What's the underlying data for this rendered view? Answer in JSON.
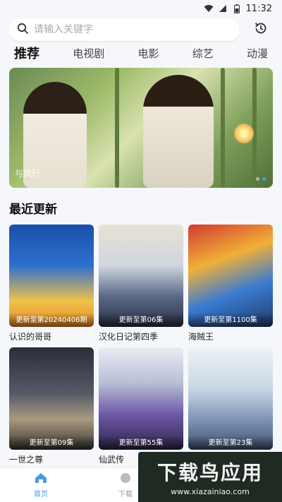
{
  "status_bar": {
    "time": "11:32"
  },
  "search": {
    "placeholder": "请输入关键字"
  },
  "tabs": [
    {
      "label": "推荐",
      "active": true
    },
    {
      "label": "电视剧"
    },
    {
      "label": "电影"
    },
    {
      "label": "综艺"
    },
    {
      "label": "动漫"
    }
  ],
  "banner": {
    "caption": "与凤行",
    "active_dot": 2,
    "dot_count": 2
  },
  "recent": {
    "title": "最近更新",
    "items": [
      {
        "title": "认识的哥哥",
        "update": "更新至第20240406期"
      },
      {
        "title": "汉化日记第四季",
        "update": "更新至第06集"
      },
      {
        "title": "海贼王",
        "update": "更新至第1100集"
      },
      {
        "title": "一世之尊",
        "update": "更新至第09集"
      },
      {
        "title": "仙武传",
        "update": "更新至第55集"
      },
      {
        "title": "",
        "update": "更新至第23集"
      }
    ]
  },
  "bottom_nav": [
    {
      "label": "首页",
      "icon": "home-icon",
      "active": true
    },
    {
      "label": "下载",
      "icon": "download-icon"
    }
  ],
  "watermark": {
    "title": "下载鸟应用",
    "url": "www.xiazainiao.com"
  },
  "colors": {
    "accent": "#4a9ae6",
    "background": "#f5f7fa"
  }
}
